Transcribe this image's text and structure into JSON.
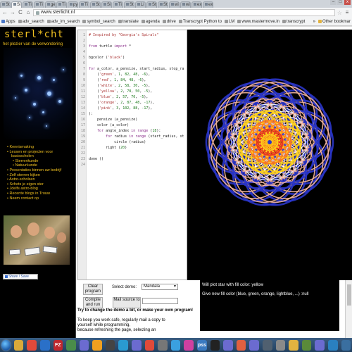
{
  "browser": {
    "tabs": [
      {
        "label": "St"
      },
      {
        "label": "Si",
        "active": true
      },
      {
        "label": "Ti"
      },
      {
        "label": "Ti"
      },
      {
        "label": "ge"
      },
      {
        "label": "Ti"
      },
      {
        "label": "py"
      },
      {
        "label": "Ti"
      },
      {
        "label": "St"
      },
      {
        "label": "Si"
      },
      {
        "label": "Ti"
      },
      {
        "label": "St"
      },
      {
        "label": "Li"
      },
      {
        "label": "St"
      },
      {
        "label": "St"
      },
      {
        "label": "wi"
      },
      {
        "label": "wi"
      },
      {
        "label": "ex"
      },
      {
        "label": "ex"
      }
    ],
    "window_controls": {
      "minimize": "–",
      "maximize": "□",
      "close": "x"
    },
    "nav": {
      "back": "←",
      "forward": "→",
      "reload": "C",
      "home": "⌂",
      "menu": "≡"
    },
    "url": "www.sterlicht.nl",
    "bookmarks": [
      "Apps",
      "adv_search",
      "adv_im_search",
      "symbol_search",
      "translate",
      "agenda",
      "drive",
      "Transcrypt Python to",
      "LM",
      "www.mastermove.in",
      "transcrypt"
    ],
    "bookmarks_overflow": "»",
    "other_bookmarks": "Other bookmar"
  },
  "site": {
    "logo": "sterl*cht",
    "slogan": "het plezier van de verwondering",
    "menu": [
      {
        "label": "Kennismaking",
        "sub": false
      },
      {
        "label": "Lessen en projecten voor",
        "sub": false
      },
      {
        "label": "basisscholen",
        "sub": false,
        "cont": true
      },
      {
        "label": "Sterrenkunde",
        "sub": true
      },
      {
        "label": "Natuurkunde",
        "sub": true
      },
      {
        "label": "Presentaties binnen uw bedrijf",
        "sub": false
      },
      {
        "label": "Zelf sterren kijken",
        "sub": false
      },
      {
        "label": "Astro-scholsen",
        "sub": false
      },
      {
        "label": "Schets je eigen ster",
        "sub": false
      },
      {
        "label": "Jdelfs astro-blog",
        "sub": false
      },
      {
        "label": "Recente blogs in Trouw",
        "sub": false
      },
      {
        "label": "Neem contact op",
        "sub": false
      }
    ],
    "share": "Share / Save"
  },
  "editor": {
    "lines": [
      {
        "n": "1",
        "parts": [
          [
            "c-com",
            "# Inspired by \"Georgia's Spirals\""
          ]
        ]
      },
      {
        "n": "2",
        "parts": []
      },
      {
        "n": "3",
        "parts": [
          [
            "c-kw",
            "from"
          ],
          [
            "c-def",
            " turtle "
          ],
          [
            "c-kw",
            "import"
          ],
          [
            "c-def",
            " *"
          ]
        ]
      },
      {
        "n": "4",
        "parts": []
      },
      {
        "n": "5",
        "parts": [
          [
            "c-def",
            "bgcolor ("
          ],
          [
            "c-str",
            "'black'"
          ],
          [
            "c-def",
            ")"
          ]
        ]
      },
      {
        "n": "6",
        "parts": []
      },
      {
        "n": "7",
        "parts": [
          [
            "c-kw",
            "for"
          ],
          [
            "c-def",
            " a_color, a_pensize, start_radius, stop_ra"
          ]
        ]
      },
      {
        "n": "8",
        "parts": [
          [
            "c-def",
            "    ("
          ],
          [
            "c-str",
            "'green'"
          ],
          [
            "c-def",
            ", "
          ],
          [
            "c-num",
            "1"
          ],
          [
            "c-def",
            ", "
          ],
          [
            "c-num",
            "82"
          ],
          [
            "c-def",
            ", "
          ],
          [
            "c-num",
            "48"
          ],
          [
            "c-def",
            ", "
          ],
          [
            "c-num",
            "-6"
          ],
          [
            "c-def",
            "),"
          ]
        ]
      },
      {
        "n": "9",
        "parts": [
          [
            "c-def",
            "    ("
          ],
          [
            "c-str",
            "'red'"
          ],
          [
            "c-def",
            ", "
          ],
          [
            "c-num",
            "1"
          ],
          [
            "c-def",
            ", "
          ],
          [
            "c-num",
            "84"
          ],
          [
            "c-def",
            ", "
          ],
          [
            "c-num",
            "48"
          ],
          [
            "c-def",
            ", "
          ],
          [
            "c-num",
            "-6"
          ],
          [
            "c-def",
            "),"
          ]
        ]
      },
      {
        "n": "10",
        "parts": [
          [
            "c-def",
            "    ("
          ],
          [
            "c-str",
            "'white'"
          ],
          [
            "c-def",
            ", "
          ],
          [
            "c-num",
            "2"
          ],
          [
            "c-def",
            ", "
          ],
          [
            "c-num",
            "58"
          ],
          [
            "c-def",
            ", "
          ],
          [
            "c-num",
            "30"
          ],
          [
            "c-def",
            ", "
          ],
          [
            "c-num",
            "-5"
          ],
          [
            "c-def",
            "),"
          ]
        ]
      },
      {
        "n": "11",
        "parts": [
          [
            "c-def",
            "    ("
          ],
          [
            "c-str",
            "'yellow'"
          ],
          [
            "c-def",
            ", "
          ],
          [
            "c-num",
            "2"
          ],
          [
            "c-def",
            ", "
          ],
          [
            "c-num",
            "78"
          ],
          [
            "c-def",
            ", "
          ],
          [
            "c-num",
            "50"
          ],
          [
            "c-def",
            ", "
          ],
          [
            "c-num",
            "-5"
          ],
          [
            "c-def",
            "),"
          ]
        ]
      },
      {
        "n": "12",
        "parts": [
          [
            "c-def",
            "    ("
          ],
          [
            "c-str",
            "'blue'"
          ],
          [
            "c-def",
            ", "
          ],
          [
            "c-num",
            "2"
          ],
          [
            "c-def",
            ", "
          ],
          [
            "c-num",
            "57"
          ],
          [
            "c-def",
            ", "
          ],
          [
            "c-num",
            "70"
          ],
          [
            "c-def",
            ", "
          ],
          [
            "c-num",
            "-5"
          ],
          [
            "c-def",
            "),"
          ]
        ]
      },
      {
        "n": "13",
        "parts": [
          [
            "c-def",
            "    ("
          ],
          [
            "c-str",
            "'orange'"
          ],
          [
            "c-def",
            ", "
          ],
          [
            "c-num",
            "2"
          ],
          [
            "c-def",
            ", "
          ],
          [
            "c-num",
            "87"
          ],
          [
            "c-def",
            ", "
          ],
          [
            "c-num",
            "48"
          ],
          [
            "c-def",
            ", "
          ],
          [
            "c-num",
            "-17"
          ],
          [
            "c-def",
            "),"
          ]
        ]
      },
      {
        "n": "14",
        "parts": [
          [
            "c-def",
            "    ("
          ],
          [
            "c-str",
            "'pink'"
          ],
          [
            "c-def",
            ", "
          ],
          [
            "c-num",
            "3"
          ],
          [
            "c-def",
            ", "
          ],
          [
            "c-num",
            "102"
          ],
          [
            "c-def",
            ", "
          ],
          [
            "c-num",
            "88"
          ],
          [
            "c-def",
            ", "
          ],
          [
            "c-num",
            "-17"
          ],
          [
            "c-def",
            "),"
          ]
        ]
      },
      {
        "n": "15",
        "parts": [
          [
            "c-def",
            "):"
          ]
        ]
      },
      {
        "n": "16",
        "parts": [
          [
            "c-def",
            "    pensize (a_pensize)"
          ]
        ]
      },
      {
        "n": "17",
        "parts": [
          [
            "c-def",
            "    color (a_color)"
          ]
        ]
      },
      {
        "n": "18",
        "parts": [
          [
            "c-def",
            "    "
          ],
          [
            "c-kw",
            "for"
          ],
          [
            "c-def",
            " angle_index "
          ],
          [
            "c-kw",
            "in"
          ],
          [
            "c-def",
            " "
          ],
          [
            "c-kw",
            "range"
          ],
          [
            "c-def",
            " ("
          ],
          [
            "c-num",
            "18"
          ],
          [
            "c-def",
            "):"
          ]
        ]
      },
      {
        "n": "19",
        "parts": [
          [
            "c-def",
            "        "
          ],
          [
            "c-kw",
            "for"
          ],
          [
            "c-def",
            " radius "
          ],
          [
            "c-kw",
            "in"
          ],
          [
            "c-def",
            " "
          ],
          [
            "c-kw",
            "range"
          ],
          [
            "c-def",
            " (start_radius, st"
          ]
        ]
      },
      {
        "n": "20",
        "parts": [
          [
            "c-def",
            "            circle (radius)"
          ]
        ]
      },
      {
        "n": "21",
        "parts": [
          [
            "c-def",
            "        right ("
          ],
          [
            "c-num",
            "20"
          ],
          [
            "c-def",
            ")"
          ]
        ]
      },
      {
        "n": "22",
        "parts": []
      },
      {
        "n": "23",
        "parts": [
          [
            "c-def",
            "done ()"
          ]
        ]
      },
      {
        "n": "24",
        "parts": []
      }
    ]
  },
  "controls": {
    "clear_program": "Clear program",
    "select_demo_label": "Select demo:",
    "demo_value": "Mandala",
    "compile_run": "Compile and run",
    "mail_source": "Mail source to",
    "mail_to_value": "",
    "hint_bold": "Try to change the demo a bit, or make your own program!",
    "hint_lines": [
      "To keep you work safe, regularly mail a copy to",
      "yourself while programming,",
      "because refreshing the page, selecting an"
    ]
  },
  "console": {
    "line1": "Will plot star with fill color: yellow",
    "line2": "Give new fill color (blue, green, orange, lightblue, ...) :null"
  },
  "colors": {
    "site_accent": "#f0c020",
    "mandala_colors": [
      "#2a35c8",
      "#f4b6a0",
      "#ffffff",
      "#ffd21a",
      "#ff7a1a",
      "#e83020"
    ]
  },
  "taskbar": {
    "icons": [
      "windows-start-icon",
      "explorer-icon",
      "chrome-icon",
      "outlook-icon",
      "filezilla-icon",
      "notepad-icon",
      "app-icon",
      "slides-icon",
      "video-icon",
      "media-icon",
      "app-icon",
      "chrome-icon",
      "search-icon",
      "earth-icon",
      "kaleidoscope-icon",
      "pss-icon",
      "terminal-icon",
      "app-icon",
      "paint-icon",
      "app-icon",
      "tasks-icon",
      "fax-icon",
      "folder-icon",
      "network-icon",
      "app-icon",
      "globe-icon",
      "python-icon"
    ],
    "tiles": {
      "pss": "pss",
      "fz": "FZ",
      "word": "W"
    }
  }
}
